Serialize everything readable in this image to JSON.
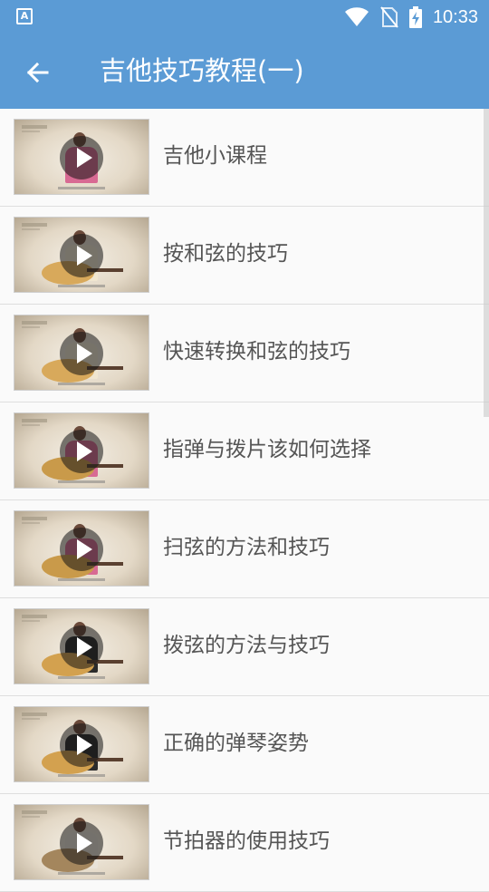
{
  "status_bar": {
    "app_icon_letter": "A",
    "time": "10:33",
    "icons": [
      "wifi-icon",
      "no-sim-icon",
      "battery-charging-icon"
    ]
  },
  "app_bar": {
    "back_icon": "arrow-left-icon",
    "title": "吉他技巧教程(一)",
    "color": "#5b9bd5"
  },
  "items": [
    {
      "label": "吉他小课程",
      "variant": "pink-shirt"
    },
    {
      "label": "按和弦的技巧",
      "variant": "yellow-guitar"
    },
    {
      "label": "快速转换和弦的技巧",
      "variant": "yellow-guitar"
    },
    {
      "label": "指弹与拨片该如何选择",
      "variant": "pink-guitar"
    },
    {
      "label": "扫弦的方法和技巧",
      "variant": "pink-guitar"
    },
    {
      "label": "拨弦的方法与技巧",
      "variant": "black-shirt"
    },
    {
      "label": "正确的弹琴姿势",
      "variant": "black-shirt"
    },
    {
      "label": "节拍器的使用技巧",
      "variant": "white-guitar"
    }
  ]
}
